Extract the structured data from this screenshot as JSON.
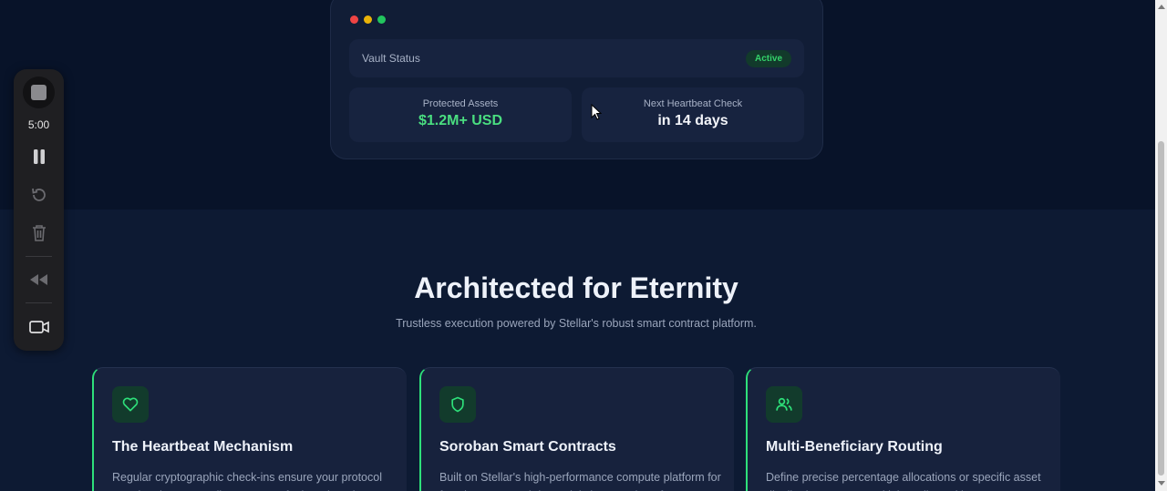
{
  "dashboard": {
    "window_dots": [
      "#ef4444",
      "#eab308",
      "#22c55e"
    ],
    "vault_status_label": "Vault Status",
    "vault_status_badge": "Active",
    "protected_assets_label": "Protected Assets",
    "protected_assets_value": "$1.2M+ USD",
    "next_check_label": "Next Heartbeat Check",
    "next_check_value": "in 14 days"
  },
  "recorder": {
    "time": "5:00",
    "icons": [
      "stop-icon",
      "pause-icon",
      "restart-icon",
      "trash-icon",
      "rewind-icon",
      "camera-icon"
    ]
  },
  "section": {
    "title": "Architected for Eternity",
    "subtitle": "Trustless execution powered by Stellar's robust smart contract platform."
  },
  "features": [
    {
      "icon": "heart-icon",
      "title": "The Heartbeat Mechanism",
      "description": "Regular cryptographic check-ins ensure your protocol remains dormant until necessary. If a heartbeat is"
    },
    {
      "icon": "shield-icon",
      "title": "Soroban Smart Contracts",
      "description": "Built on Stellar's high-performance compute platform for fast, low-cost, and deterministic execution of"
    },
    {
      "icon": "users-icon",
      "title": "Multi-Beneficiary Routing",
      "description": "Define precise percentage allocations or specific asset distributions across multiple wallets with"
    }
  ],
  "colors": {
    "accent": "#2ee07a",
    "value_green": "#4ade80",
    "background": "#0a1428"
  }
}
